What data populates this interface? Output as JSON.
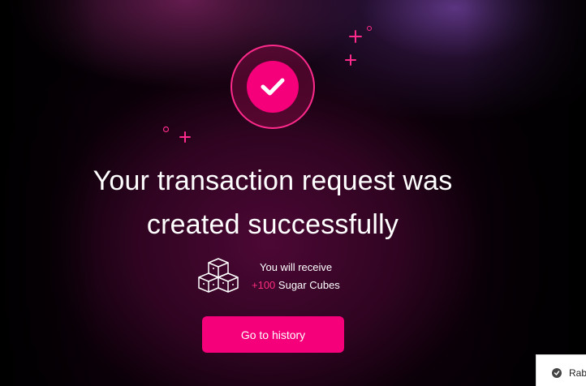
{
  "success": {
    "title": "Your transaction request was created successfully",
    "reward_line1": "You will receive",
    "reward_amount": "+100",
    "reward_unit": "Sugar Cubes",
    "button_label": "Go to history"
  },
  "extension_popup": {
    "label": "Rab"
  },
  "icons": {
    "check": "checkmark-icon",
    "reward": "sugar-cubes-icon",
    "sparkle": "sparkle-icon",
    "extension": "extension-icon"
  },
  "colors": {
    "accent": "#f5007a",
    "accent_text": "#ff2d7e",
    "background": "#050005",
    "text": "#ffffff"
  }
}
